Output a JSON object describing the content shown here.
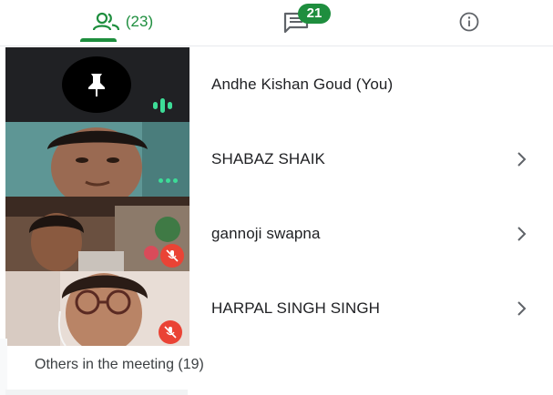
{
  "tabs": {
    "people_count": "(23)",
    "chat_badge": "21"
  },
  "participants": [
    {
      "name": "Andhe Kishan Goud (You)",
      "status": "speaking",
      "pinned_control": "pin-icon"
    },
    {
      "name": "SHABAZ SHAIK",
      "status": "speaking"
    },
    {
      "name": "gannoji swapna",
      "status": "muted"
    },
    {
      "name": "HARPAL SINGH SINGH",
      "status": "muted"
    }
  ],
  "others": {
    "label": "Others in the meeting (19)"
  },
  "colors": {
    "accent_green": "#1e8e3e",
    "mute_red": "#ea4335",
    "speaking_green": "#3ddc97",
    "tile_dark": "#202124"
  }
}
